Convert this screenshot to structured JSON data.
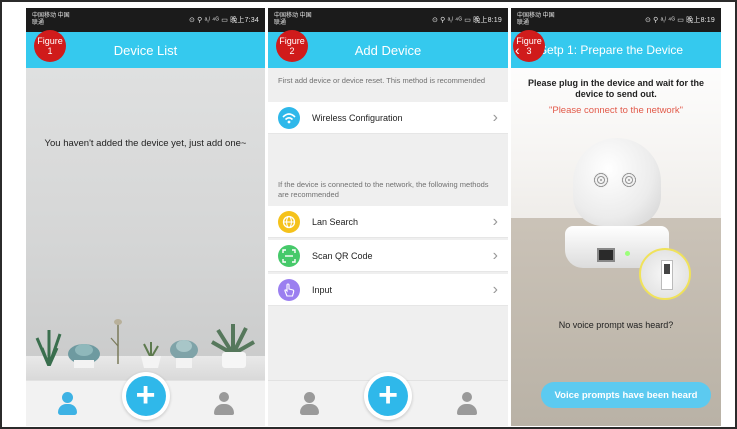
{
  "figures": [
    {
      "label": "Figure",
      "number": "1"
    },
    {
      "label": "Figure",
      "number": "2"
    },
    {
      "label": "Figure",
      "number": "3"
    }
  ],
  "status": {
    "carrier": "中国移动 中国联通",
    "p1_right": "⊙ ⚲ ᵃᵢˡ ⁴ᴳ ▭ 晚上7:34",
    "p2_right": "⊙ ⚲ ᵃᵢˡ ⁴ᴳ ▭ 晚上8:19",
    "p3_right": "⊙ ⚲ ᵃᵢˡ ⁴ᴳ ▭ 晚上8:19"
  },
  "panel1": {
    "title": "Device List",
    "empty_message": "You haven't added the device yet, just add one~"
  },
  "panel2": {
    "title": "Add Device",
    "hint_first": "First add device or device reset. This method is recommended",
    "hint_second": "If the device is connected to the network, the following methods are recommended",
    "items": [
      {
        "label": "Wireless Configuration",
        "icon": "wifi-icon",
        "color": "#2fb8ea"
      },
      {
        "label": "Lan Search",
        "icon": "globe-icon",
        "color": "#f5c21b"
      },
      {
        "label": "Scan QR Code",
        "icon": "qr-scan-icon",
        "color": "#46c96a"
      },
      {
        "label": "Input",
        "icon": "hand-pointer-icon",
        "color": "#9b7ff0"
      }
    ]
  },
  "panel3": {
    "title": "Setp 1: Prepare the Device",
    "instruction": "Please plug in the device and wait for the device to send out.",
    "network_prompt": "\"Please connect to the network\"",
    "no_voice": "No voice prompt was heard?",
    "heard_button": "Voice prompts have been heard"
  },
  "colors": {
    "accent": "#35c9ee",
    "badge": "#d01b1b",
    "prompt_red": "#e25a4a",
    "button_blue": "#5ccaf0"
  }
}
